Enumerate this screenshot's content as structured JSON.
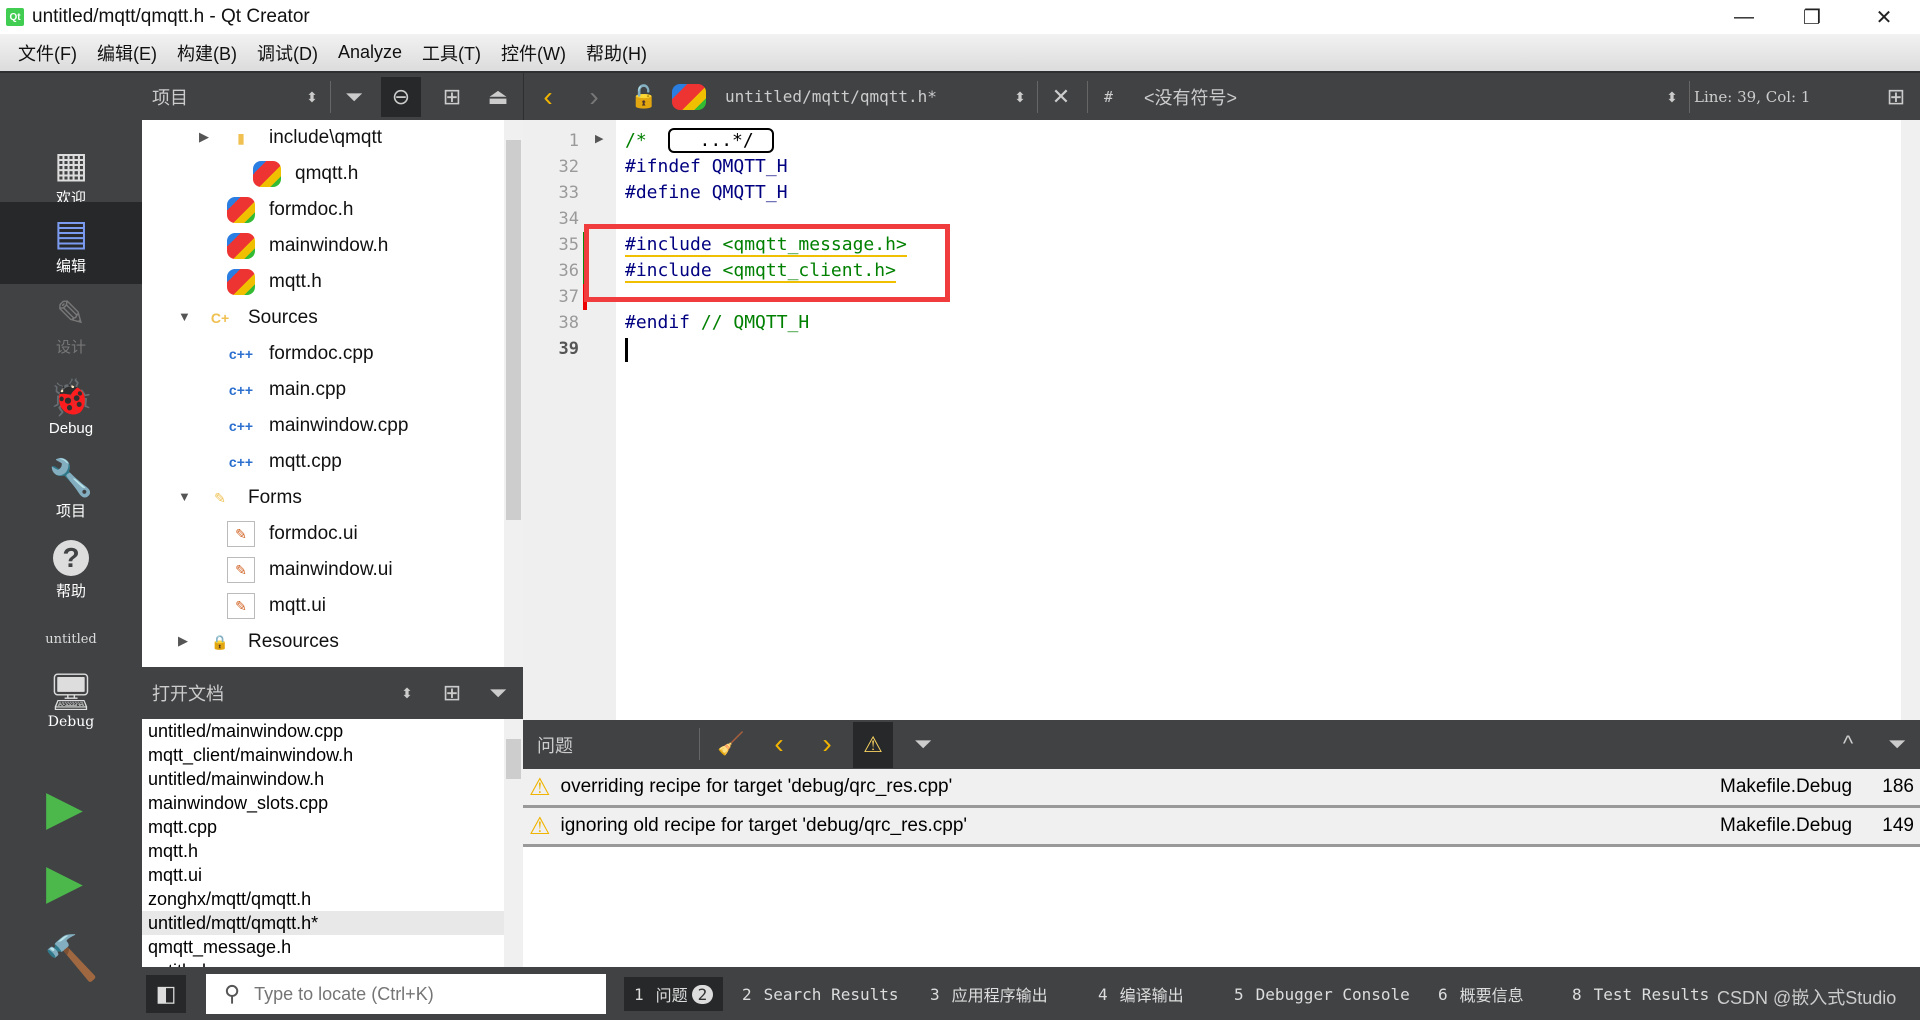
{
  "window": {
    "title": "untitled/mqtt/qmqtt.h - Qt Creator",
    "minimize": "—",
    "restore": "❐",
    "close": "✕"
  },
  "menu": [
    "文件(F)",
    "编辑(E)",
    "构建(B)",
    "调试(D)",
    "Analyze",
    "工具(T)",
    "控件(W)",
    "帮助(H)"
  ],
  "toolbar": {
    "project_selector": "项目",
    "file_name": "untitled/mqtt/qmqtt.h*",
    "symbol_hash": "#",
    "symbol": "<没有符号>",
    "position": "Line: 39, Col: 1"
  },
  "modes": [
    {
      "label": "欢迎",
      "icon": "grid-icon"
    },
    {
      "label": "编辑",
      "icon": "edit-document-icon",
      "selected": true
    },
    {
      "label": "设计",
      "icon": "pencil-icon",
      "disabled": true
    },
    {
      "label": "Debug",
      "icon": "bug-icon"
    },
    {
      "label": "项目",
      "icon": "wrench-icon"
    },
    {
      "label": "帮助",
      "icon": "help-icon"
    }
  ],
  "kit": {
    "project": "untitled",
    "config": "Debug"
  },
  "tree": [
    {
      "label": "include\\qmqtt",
      "type": "folder",
      "level": 2,
      "arrow": "right"
    },
    {
      "label": "qmqtt.h",
      "type": "header",
      "level": 3
    },
    {
      "label": "formdoc.h",
      "type": "header",
      "level": 2
    },
    {
      "label": "mainwindow.h",
      "type": "header",
      "level": 2
    },
    {
      "label": "mqtt.h",
      "type": "header",
      "level": 2
    },
    {
      "label": "Sources",
      "type": "cppfolder",
      "level": 1,
      "arrow": "down"
    },
    {
      "label": "formdoc.cpp",
      "type": "cpp",
      "level": 2
    },
    {
      "label": "main.cpp",
      "type": "cpp",
      "level": 2
    },
    {
      "label": "mainwindow.cpp",
      "type": "cpp",
      "level": 2
    },
    {
      "label": "mqtt.cpp",
      "type": "cpp",
      "level": 2
    },
    {
      "label": "Forms",
      "type": "formfolder",
      "level": 1,
      "arrow": "down"
    },
    {
      "label": "formdoc.ui",
      "type": "ui",
      "level": 2
    },
    {
      "label": "mainwindow.ui",
      "type": "ui",
      "level": 2
    },
    {
      "label": "mqtt.ui",
      "type": "ui",
      "level": 2
    },
    {
      "label": "Resources",
      "type": "resfolder",
      "level": 1,
      "arrow": "right"
    }
  ],
  "open_docs": {
    "title": "打开文档",
    "items": [
      "untitled/mainwindow.cpp",
      "mqtt_client/mainwindow.h",
      "untitled/mainwindow.h",
      "mainwindow_slots.cpp",
      "mqtt.cpp",
      "mqtt.h",
      "mqtt.ui",
      "zonghx/mqtt/qmqtt.h",
      "untitled/mqtt/qmqtt.h*",
      "qmqtt_message.h",
      "untitled.pro"
    ],
    "selected": "untitled/mqtt/qmqtt.h*"
  },
  "editor": {
    "lines": [
      {
        "n": "1",
        "parts": [
          [
            "cm",
            "/* "
          ],
          [
            "fold",
            "...*/"
          ]
        ]
      },
      {
        "n": "32",
        "parts": [
          [
            "pp",
            "#ifndef QMQTT_H"
          ]
        ]
      },
      {
        "n": "33",
        "parts": [
          [
            "pp",
            "#define QMQTT_H"
          ]
        ]
      },
      {
        "n": "34",
        "parts": []
      },
      {
        "n": "35",
        "parts": [
          [
            "pp",
            "#include "
          ],
          [
            "str",
            "<qmqtt_message.h>"
          ]
        ],
        "mark": "added"
      },
      {
        "n": "36",
        "parts": [
          [
            "pp",
            "#include "
          ],
          [
            "str",
            "<qmqtt_client.h>"
          ]
        ],
        "mark": "added"
      },
      {
        "n": "37",
        "parts": [],
        "mark": "removed"
      },
      {
        "n": "38",
        "parts": [
          [
            "pp",
            "#endif "
          ],
          [
            "cm",
            "// QMQTT_H"
          ]
        ]
      },
      {
        "n": "39",
        "parts": [],
        "current": true
      }
    ],
    "highlight_color": "#f03c3c"
  },
  "issues": {
    "title": "问题",
    "rows": [
      {
        "text": "overriding recipe for target 'debug/qrc_res.cpp'",
        "file": "Makefile.Debug",
        "line": "186"
      },
      {
        "text": "ignoring old recipe for target 'debug/qrc_res.cpp'",
        "file": "Makefile.Debug",
        "line": "149"
      }
    ]
  },
  "bottom": {
    "locator_placeholder": "Type to locate (Ctrl+K)",
    "panes": [
      {
        "num": "1",
        "label": "问题",
        "badge": "2",
        "active": true
      },
      {
        "num": "2",
        "label": "Search Results"
      },
      {
        "num": "3",
        "label": "应用程序输出"
      },
      {
        "num": "4",
        "label": "编译输出"
      },
      {
        "num": "5",
        "label": "Debugger Console"
      },
      {
        "num": "6",
        "label": "概要信息"
      },
      {
        "num": "8",
        "label": "Test Results"
      }
    ],
    "watermark": "CSDN @嵌入式Studio"
  }
}
